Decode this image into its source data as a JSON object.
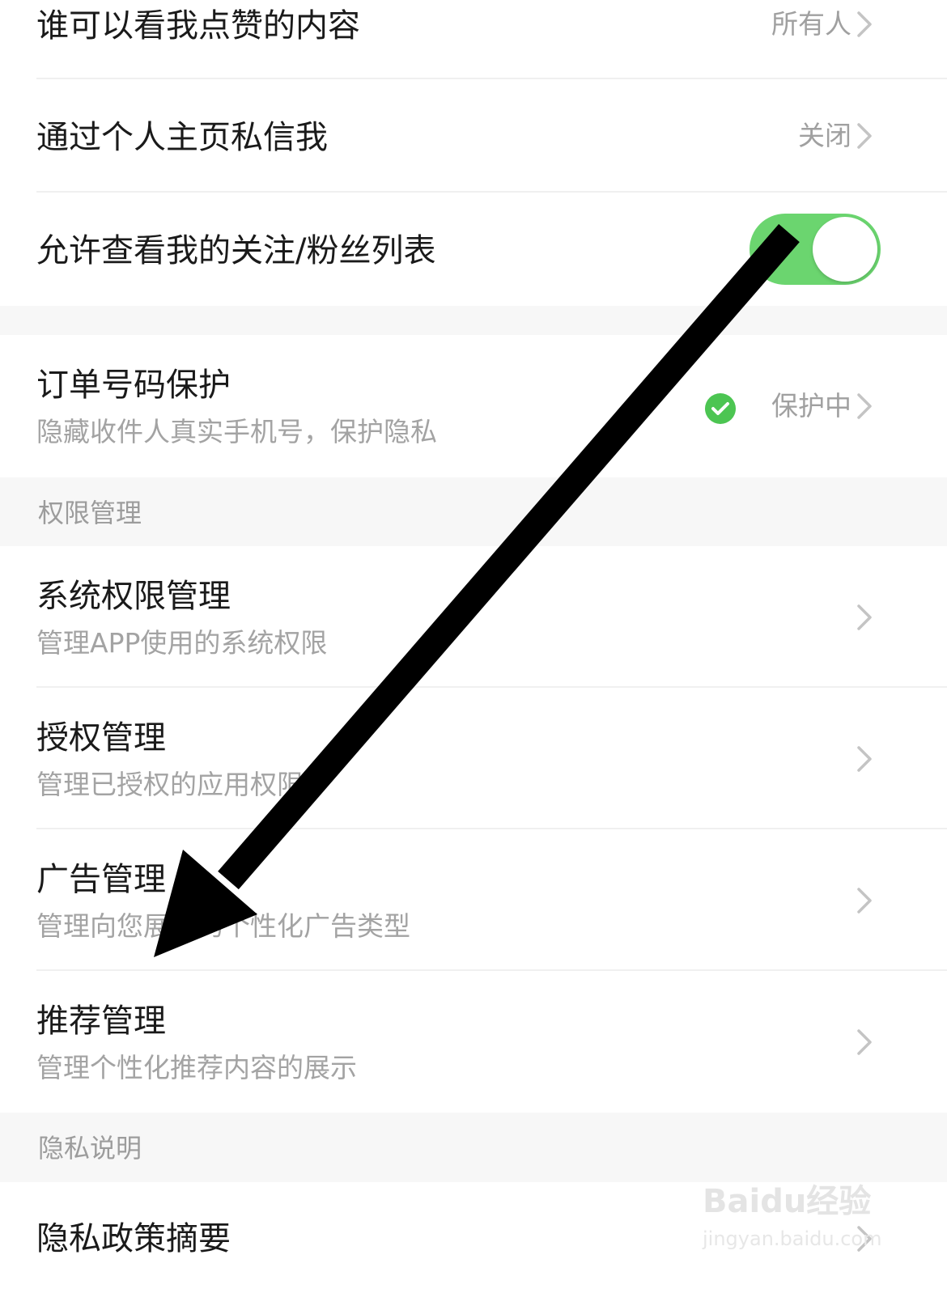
{
  "settings": [
    {
      "title": "谁可以看我点赞的内容",
      "value": "所有人"
    },
    {
      "title": "通过个人主页私信我",
      "value": "关闭"
    },
    {
      "title": "允许查看我的关注/粉丝列表",
      "toggle": true
    }
  ],
  "order_protection": {
    "title": "订单号码保护",
    "subtitle": "隐藏收件人真实手机号，保护隐私",
    "status": "保护中"
  },
  "sections": {
    "permissions": "权限管理",
    "privacy": "隐私说明"
  },
  "permission_items": [
    {
      "title": "系统权限管理",
      "subtitle": "管理APP使用的系统权限"
    },
    {
      "title": "授权管理",
      "subtitle": "管理已授权的应用权限"
    },
    {
      "title": "广告管理",
      "subtitle": "管理向您展示的个性化广告类型"
    },
    {
      "title": "推荐管理",
      "subtitle": "管理个性化推荐内容的展示"
    }
  ],
  "privacy_items": [
    {
      "title": "隐私政策摘要"
    }
  ],
  "watermark": {
    "brand": "Baidu经验",
    "url": "jingyan.baidu.com"
  },
  "colors": {
    "toggle_on": "#6bd56f",
    "check_green": "#4cc552",
    "annotation_arrow": "#000000"
  },
  "icons": [
    "chevron-right-icon",
    "check-circle-icon",
    "arrow-annotation"
  ]
}
